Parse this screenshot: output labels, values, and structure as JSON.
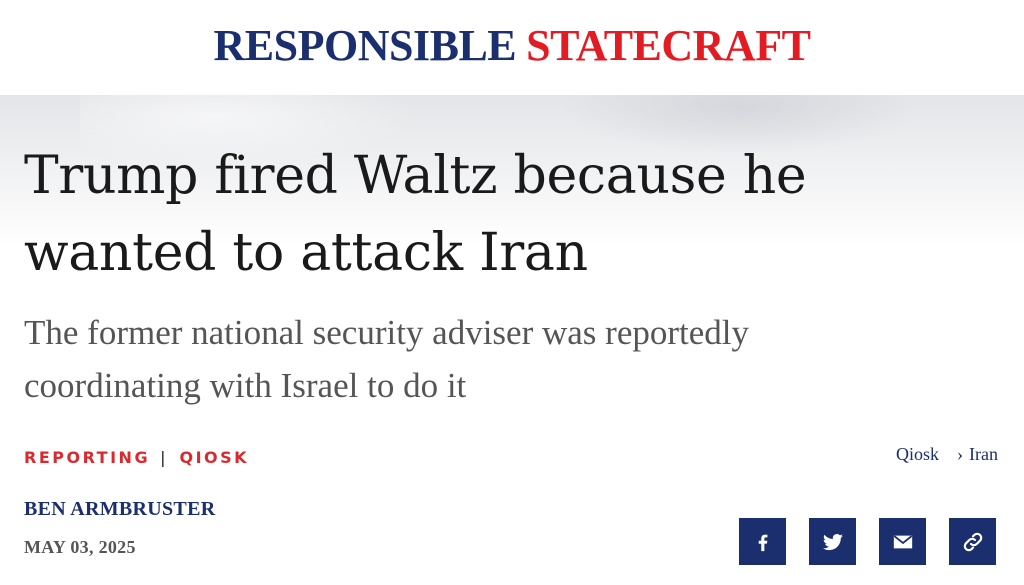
{
  "site": {
    "name_part1": "RESPONSIBLE",
    "name_part2": "STATECRAFT"
  },
  "article": {
    "headline": "Trump fired Waltz because he wanted to attack Iran",
    "subheadline": "The former national security adviser was reportedly coordinating with Israel to do it",
    "tags": [
      "REPORTING",
      "QIOSK"
    ],
    "tag_separator": "|",
    "breadcrumb": [
      {
        "label": "Qiosk"
      },
      {
        "label": "Iran"
      }
    ],
    "breadcrumb_separator": "›",
    "author": "BEN ARMBRUSTER",
    "date": "MAY 03, 2025"
  },
  "share": {
    "buttons": [
      {
        "icon": "facebook-icon"
      },
      {
        "icon": "twitter-icon"
      },
      {
        "icon": "email-icon"
      },
      {
        "icon": "link-icon"
      }
    ]
  },
  "colors": {
    "navy": "#1b2e6e",
    "red": "#e31b23",
    "tag_red": "#d92a2f",
    "text": "#1a1a1a",
    "muted": "#555555"
  }
}
